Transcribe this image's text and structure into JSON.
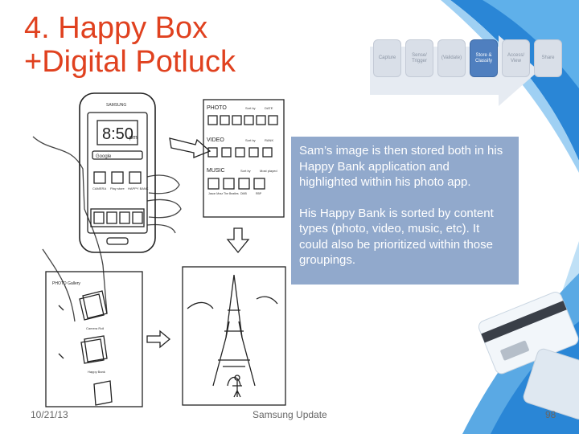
{
  "slide": {
    "title_line1": "4. Happy Box",
    "title_line2": "+Digital Potluck",
    "footer": {
      "date": "10/21/13",
      "center": "Samsung Update",
      "page": "98"
    }
  },
  "process_steps": [
    {
      "label": "Capture",
      "active": false
    },
    {
      "label": "Sense/ Trigger",
      "active": false
    },
    {
      "label": "(Validate)",
      "active": false
    },
    {
      "label": "Store & Classify",
      "active": true
    },
    {
      "label": "Access/ View",
      "active": false
    },
    {
      "label": "Share",
      "active": false
    }
  ],
  "callout": {
    "paragraph1": "Sam’s image is then stored both in his Happy Bank application and highlighted within his photo app.",
    "paragraph2": "His Happy Bank is sorted by content types (photo, video, music, etc).  It could also be prioritized within those groupings."
  },
  "sketch": {
    "phone_time": "8:50",
    "phone_time_suffix": "pm",
    "phone_brand": "SAMSUNG",
    "search_label": "Google",
    "app_labels": [
      "CAMERA",
      "Play store",
      "HAPPY BANK"
    ],
    "sections": [
      "PHOTO",
      "VIDEO",
      "MUSIC"
    ],
    "sort_label": "Sort by",
    "sort_values": [
      "DATE",
      "RANK",
      "Most played"
    ],
    "music_labels": [
      "Jason Mraz",
      "The Beatles",
      "DMB",
      "RBP"
    ],
    "gallery_title": "PHOTO Gallery",
    "gallery_labels": [
      "Camera Roll",
      "Happy Bank"
    ]
  },
  "colors": {
    "title": "#e0411f",
    "callout_bg": "#91a9cc",
    "active_step": "#4f7fbf",
    "inactive_step": "#d9dfe8",
    "deco_blue": "#2a86d6"
  }
}
